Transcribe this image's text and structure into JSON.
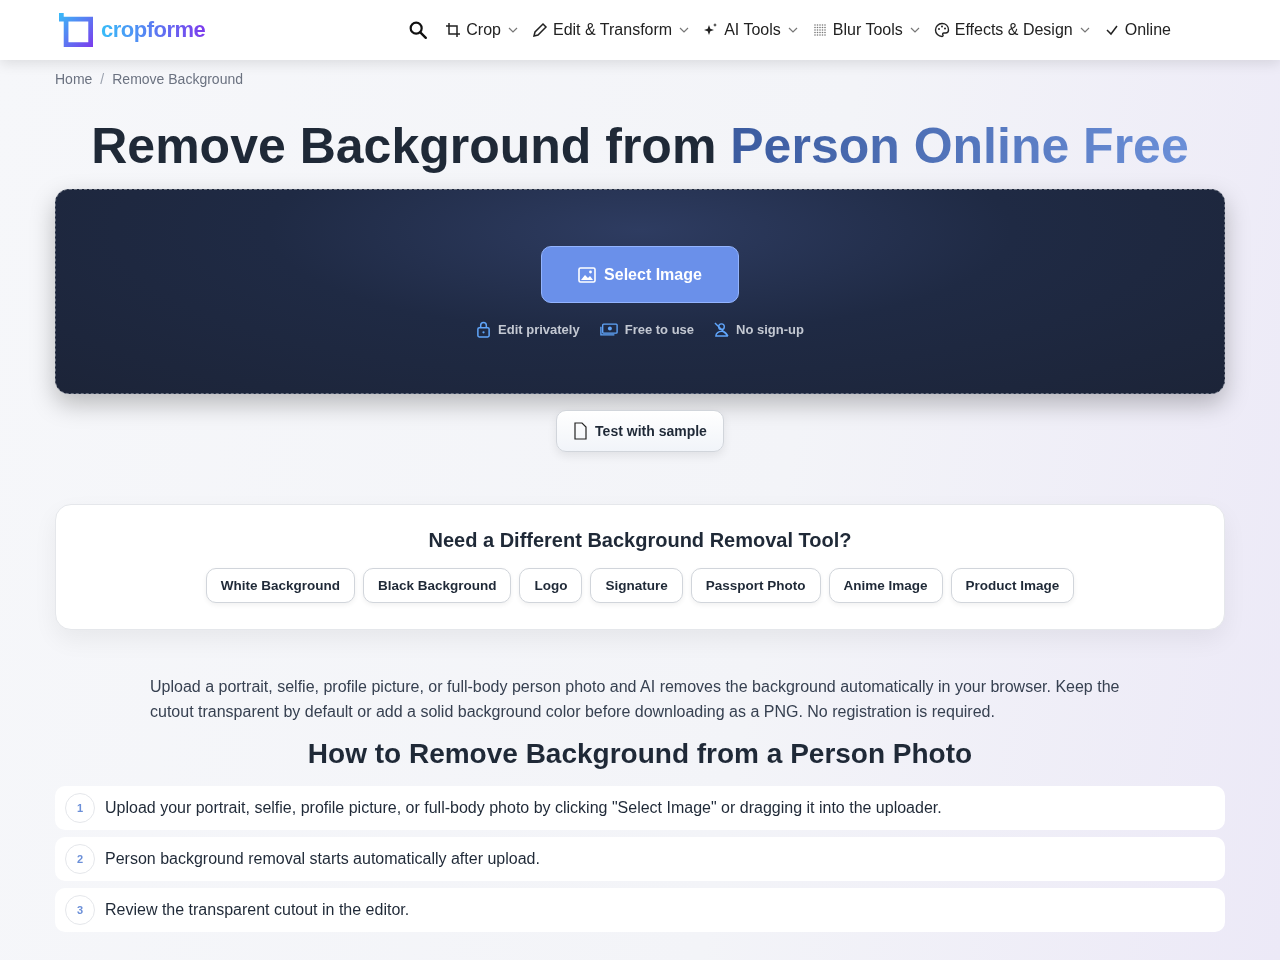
{
  "header": {
    "logo": "cropforme",
    "nav": [
      {
        "label": "Crop",
        "kind": "crop"
      },
      {
        "label": "Edit & Transform",
        "kind": "edit"
      },
      {
        "label": "AI Tools",
        "kind": "ai"
      },
      {
        "label": "Blur Tools",
        "kind": "blur"
      },
      {
        "label": "Effects & Design",
        "kind": "effects"
      },
      {
        "label": "Online",
        "kind": "other"
      }
    ]
  },
  "breadcrumb": {
    "separator": "/",
    "items": [
      "Home",
      "Remove Background"
    ]
  },
  "title": {
    "plain": "Remove Background from ",
    "accent": "Person Online Free"
  },
  "uploader": {
    "button": "Select Image",
    "features": [
      {
        "label": "Edit privately",
        "kind": "lock"
      },
      {
        "label": "Free to use",
        "kind": "money"
      },
      {
        "label": "No sign-up",
        "kind": "nouser"
      }
    ]
  },
  "sample_button": "Test with sample",
  "tools_card": {
    "title": "Need a Different Background Removal Tool?",
    "chips": [
      "White Background",
      "Black Background",
      "Logo",
      "Signature",
      "Passport Photo",
      "Anime Image",
      "Product Image"
    ]
  },
  "intro": "Upload a portrait, selfie, profile picture, or full-body person photo and AI removes the background automatically in your browser. Keep the cutout transparent by default or add a solid background color before downloading as a PNG. No registration is required.",
  "how_to": {
    "title": "How to Remove Background from a Person Photo",
    "steps": [
      {
        "number": "1",
        "text": "Upload your portrait, selfie, profile picture, or full-body photo by clicking \"Select Image\" or dragging it into the uploader."
      },
      {
        "number": "2",
        "text": "Person background removal starts automatically after upload."
      },
      {
        "number": "3",
        "text": "Review the transparent cutout in the editor."
      }
    ]
  }
}
